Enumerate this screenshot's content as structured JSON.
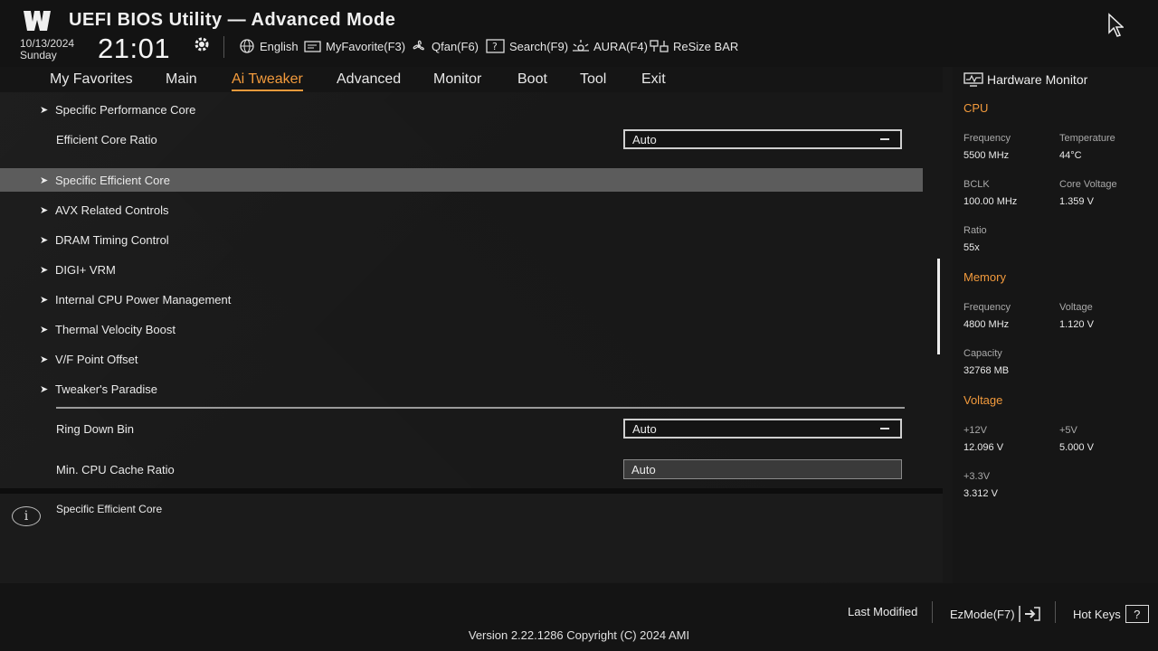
{
  "header": {
    "app_title": "UEFI BIOS Utility — Advanced Mode",
    "date": "10/13/2024",
    "day": "Sunday",
    "time": "21:01",
    "toolbar": [
      {
        "label": "English",
        "icon": "globe-icon"
      },
      {
        "label": "MyFavorite(F3)",
        "icon": "favorite-icon"
      },
      {
        "label": "Qfan(F6)",
        "icon": "fan-icon"
      },
      {
        "label": "Search(F9)",
        "icon": "search-icon"
      },
      {
        "label": "AURA(F4)",
        "icon": "aura-icon"
      },
      {
        "label": "ReSize BAR",
        "icon": "resize-bar-icon"
      }
    ]
  },
  "tabs": [
    {
      "label": "My Favorites"
    },
    {
      "label": "Main"
    },
    {
      "label": "Ai Tweaker",
      "active": true
    },
    {
      "label": "Advanced"
    },
    {
      "label": "Monitor"
    },
    {
      "label": "Boot"
    },
    {
      "label": "Tool"
    },
    {
      "label": "Exit"
    }
  ],
  "main": {
    "items": [
      {
        "label": "Specific Performance Core",
        "type": "submenu"
      },
      {
        "label": "Efficient Core Ratio",
        "type": "dropdown",
        "value": "Auto"
      },
      {
        "label": "Specific Efficient Core",
        "type": "submenu",
        "selected": true
      },
      {
        "label": "AVX Related Controls",
        "type": "submenu"
      },
      {
        "label": "DRAM Timing Control",
        "type": "submenu"
      },
      {
        "label": "DIGI+ VRM",
        "type": "submenu"
      },
      {
        "label": "Internal CPU Power Management",
        "type": "submenu"
      },
      {
        "label": "Thermal Velocity Boost",
        "type": "submenu"
      },
      {
        "label": "V/F Point Offset",
        "type": "submenu"
      },
      {
        "label": "Tweaker's Paradise",
        "type": "submenu"
      },
      {
        "label": "Ring Down Bin",
        "type": "dropdown",
        "value": "Auto"
      },
      {
        "label": "Min. CPU Cache Ratio",
        "type": "input",
        "value": "Auto"
      }
    ]
  },
  "info": {
    "text": "Specific Efficient Core",
    "icon_glyph": "i"
  },
  "hardware_monitor": {
    "title": "Hardware Monitor",
    "cpu": {
      "heading": "CPU",
      "frequency_label": "Frequency",
      "frequency": "5500 MHz",
      "temperature_label": "Temperature",
      "temperature": "44°C",
      "bclk_label": "BCLK",
      "bclk": "100.00 MHz",
      "core_voltage_label": "Core Voltage",
      "core_voltage": "1.359 V",
      "ratio_label": "Ratio",
      "ratio": "55x"
    },
    "memory": {
      "heading": "Memory",
      "frequency_label": "Frequency",
      "frequency": "4800 MHz",
      "voltage_label": "Voltage",
      "voltage": "1.120 V",
      "capacity_label": "Capacity",
      "capacity": "32768 MB"
    },
    "voltage": {
      "heading": "Voltage",
      "v12_label": "+12V",
      "v12": "12.096 V",
      "v5_label": "+5V",
      "v5": "5.000 V",
      "v33_label": "+3.3V",
      "v33": "3.312 V"
    }
  },
  "footer": {
    "last_modified": "Last Modified",
    "ezmode": "EzMode(F7)",
    "hotkeys": "Hot Keys",
    "hotkeys_glyph": "?",
    "version": "Version 2.22.1286 Copyright (C) 2024 AMI"
  },
  "colors": {
    "accent": "#f29a3c",
    "selected_row": "#5c5c5c",
    "background": "#181818"
  }
}
